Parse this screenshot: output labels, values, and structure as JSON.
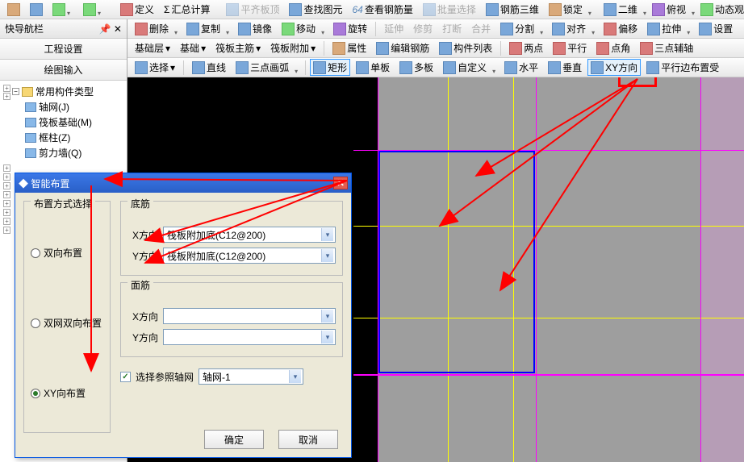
{
  "top_toolbar": {
    "items": [
      "定义",
      "汇总计算",
      "平齐板顶",
      "查找图元",
      "查看钢筋量",
      "批量选择",
      "钢筋三维",
      "锁定",
      "二维",
      "俯视",
      "动态观"
    ]
  },
  "nav_panel": {
    "title": "快导航栏",
    "tabs": [
      "工程设置",
      "绘图输入"
    ],
    "tree_root": "常用构件类型",
    "tree_items": [
      {
        "label": "轴网(J)"
      },
      {
        "label": "筏板基础(M)"
      },
      {
        "label": "框柱(Z)"
      },
      {
        "label": "剪力墙(Q)"
      }
    ]
  },
  "toolbars": {
    "t1": [
      "删除",
      "复制",
      "镜像",
      "移动",
      "旋转",
      "延伸",
      "修剪",
      "打断",
      "合并",
      "分割",
      "对齐",
      "偏移",
      "拉伸",
      "设置"
    ],
    "t2": [
      "基础层",
      "基础",
      "筏板主筋",
      "筏板附加",
      "属性",
      "编辑钢筋",
      "构件列表",
      "两点",
      "平行",
      "点角",
      "三点辅轴"
    ],
    "t3_select": "选择",
    "t3": [
      "直线",
      "三点画弧",
      "矩形",
      "单板",
      "多板",
      "自定义",
      "水平",
      "垂直",
      "XY方向",
      "平行边布置受"
    ]
  },
  "dialog": {
    "title": "智能布置",
    "layout_group": "布置方式选择",
    "radio1": "双向布置",
    "radio2": "双网双向布置",
    "radio3": "XY向布置",
    "bottom_group": "底筋",
    "top_group": "面筋",
    "xdir": "X方向",
    "ydir": "Y方向",
    "bottom_x_val": "筏板附加底(C12@200)",
    "bottom_y_val": "筏板附加底(C12@200)",
    "ref_axis_chk": "选择参照轴网",
    "ref_axis_val": "轴网-1",
    "ok": "确定",
    "cancel": "取消"
  },
  "chart_data": null
}
